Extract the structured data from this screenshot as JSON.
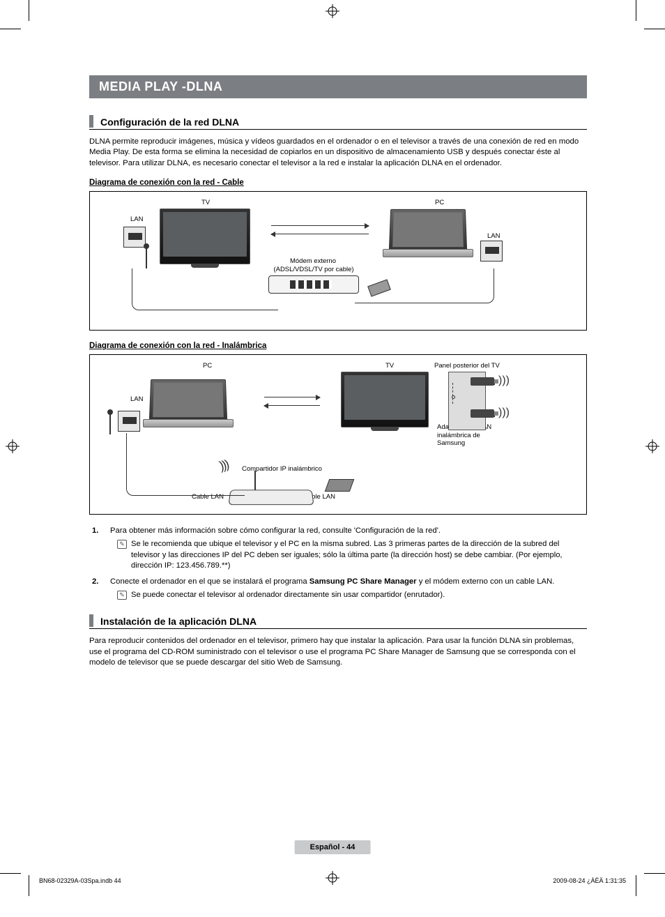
{
  "page_title": "MEDIA PLAY -DLNA",
  "section1": {
    "title": "Configuración de la red DLNA",
    "body": "DLNA permite reproducir imágenes, música y vídeos guardados en el ordenador o en el televisor a través de una conexión de red en modo Media Play. De esta forma se elimina la necesidad de copiarlos en un dispositivo de almacenamiento USB y después conectar éste al televisor. Para utilizar DLNA, es necesario conectar el televisor a la red e instalar la aplicación DLNA en el ordenador."
  },
  "diagram1": {
    "heading": "Diagrama de conexión con la red - Cable",
    "labels": {
      "tv": "TV",
      "pc": "PC",
      "lan_left": "LAN",
      "lan_right": "LAN",
      "modem_line1": "Módem externo",
      "modem_line2": "(ADSL/VDSL/TV por cable)"
    }
  },
  "diagram2": {
    "heading": "Diagrama de conexión con la red - Inalámbrica",
    "labels": {
      "pc": "PC",
      "tv": "TV",
      "panel": "Panel posterior del TV",
      "lan": "LAN",
      "adapter": "Adaptador de LAN inalámbrica de Samsung",
      "sharer": "Compartidor IP inalámbrico",
      "cable_lan_l": "Cable LAN",
      "cable_lan_r": "Cable LAN"
    }
  },
  "list": {
    "item1": "Para obtener más información sobre cómo configurar la red, consulte 'Configuración de la red'.",
    "note1": "Se le recomienda que ubique el televisor y el PC en la misma subred. Las 3 primeras partes de la dirección de la subred del televisor y las direcciones IP del PC deben ser iguales; sólo la última parte (la dirección host) se debe cambiar. (Por ejemplo, dirección IP: 123.456.789.**)",
    "item2_pre": "Conecte el ordenador en el que se instalará el programa ",
    "item2_bold": "Samsung PC Share Manager",
    "item2_post": " y el módem externo con un cable LAN.",
    "note2": "Se puede conectar el televisor al ordenador directamente sin usar compartidor (enrutador)."
  },
  "section2": {
    "title": "Instalación de la aplicación DLNA",
    "body": "Para reproducir contenidos del ordenador en el televisor, primero hay que instalar la aplicación. Para usar la función DLNA sin problemas, use el programa del CD-ROM suministrado con el televisor o use el programa PC Share Manager de Samsung que se corresponda con el modelo de televisor que se puede descargar del sitio Web de Samsung."
  },
  "footer": {
    "band": "Español - 44",
    "doc_id": "BN68-02329A-03Spa.indb   44",
    "timestamp": "2009-08-24   ¿ÀÈÄ 1:31:35"
  }
}
